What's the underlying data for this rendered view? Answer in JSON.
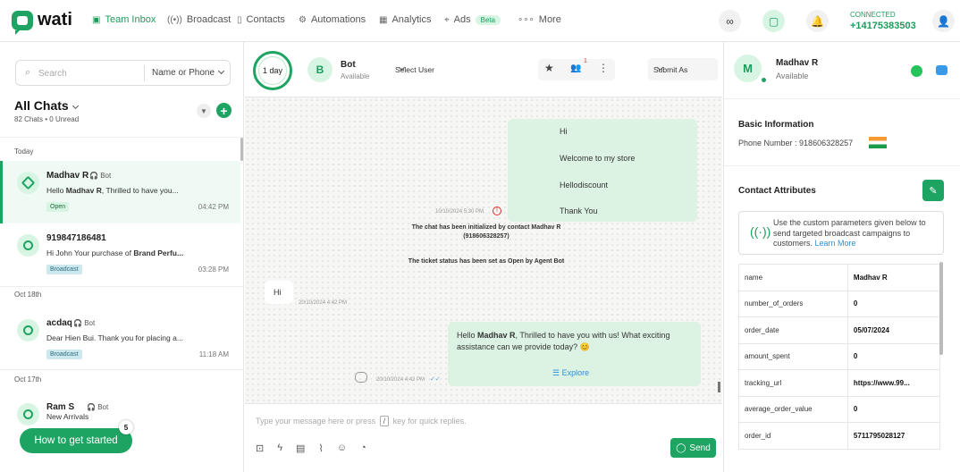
{
  "brand": {
    "name": "wati",
    "accent": "#1da462"
  },
  "nav": {
    "items": [
      {
        "label": "Team Inbox",
        "icon": "inbox-icon"
      },
      {
        "label": "Broadcast",
        "icon": "broadcast-icon"
      },
      {
        "label": "Contacts",
        "icon": "contacts-icon"
      },
      {
        "label": "Automations",
        "icon": "automations-icon"
      },
      {
        "label": "Analytics",
        "icon": "analytics-icon"
      },
      {
        "label": "Ads",
        "icon": "ads-icon",
        "badge": "Beta"
      },
      {
        "label": "More",
        "icon": "more-icon"
      }
    ],
    "connected_label": "CONNECTED",
    "phone": "+14175383503"
  },
  "left": {
    "search_placeholder": "Search",
    "search_mode": "Name or Phone",
    "title": "All Chats",
    "chat_count": "82 Chats",
    "unread": "0 Unread",
    "day_today": "Today",
    "day_oct18": "Oct 18th",
    "day_oct17": "Oct 17th",
    "chats": [
      {
        "name": "Madhav R",
        "bot": "Bot",
        "preview_prefix": "Hello ",
        "preview_bold": "Madhav R",
        "preview_suffix": ", Thrilled to have you...",
        "tag": "Open",
        "time": "04:42 PM"
      },
      {
        "name": "919847186481",
        "preview_prefix": "Hi John Your purchase of ",
        "preview_bold": "Brand Perfu...",
        "tag": "Broadcast",
        "time": "03:28 PM"
      },
      {
        "name": "acdaq",
        "bot": "Bot",
        "preview": "Dear Hien Bui. Thank you for placing a...",
        "tag": "Broadcast",
        "time": "11:18 AM"
      },
      {
        "name": "Ram S",
        "bot": "Bot",
        "preview": "New Arrivals"
      }
    ],
    "howto": "How to get started",
    "howto_badge": "5"
  },
  "center": {
    "timer": "1 day",
    "bot_initial": "B",
    "bot_name": "Bot",
    "bot_status": "Available",
    "select_user": "Select User",
    "notif_count": "1",
    "submit_as": "Submit As",
    "out_lines": [
      "Hi",
      "Welcome to my store",
      "Hellodiscount",
      "Thank You"
    ],
    "out_time": "10/10/2024 5:30 PM",
    "sys1_line1": "The chat has been initialized by contact Madhav R",
    "sys1_line2": "(918606328257)",
    "sys2": "The ticket status has been set as Open by Agent Bot",
    "in_msg": "Hi",
    "in_time": "20/10/2024 4:42 PM",
    "reply_prefix": "Hello ",
    "reply_bold": "Madhav R",
    "reply_suffix": ", Thrilled to have you with us! What exciting assistance can we provide today? 😊",
    "explore": "Explore",
    "reply_time": "20/10/2024 4:42 PM",
    "composer_before": "Type your message here or press ",
    "composer_key": "/",
    "composer_after": " key for quick replies.",
    "send": "Send"
  },
  "right": {
    "initial": "M",
    "name": "Madhav R",
    "status": "Available",
    "basic_title": "Basic Information",
    "phone_label": "Phone Number : ",
    "phone": "918606328257",
    "attr_title": "Contact Attributes",
    "info_text": "Use the custom parameters given below to send targeted broadcast campaigns to customers. ",
    "learn_more": "Learn More",
    "attributes": [
      [
        "name",
        "Madhav R"
      ],
      [
        "number_of_orders",
        "0"
      ],
      [
        "order_date",
        "05/07/2024"
      ],
      [
        "amount_spent",
        "0"
      ],
      [
        "tracking_url",
        "https://www.99..."
      ],
      [
        "average_order_value",
        "0"
      ],
      [
        "order_id",
        "5711795028127"
      ]
    ]
  }
}
